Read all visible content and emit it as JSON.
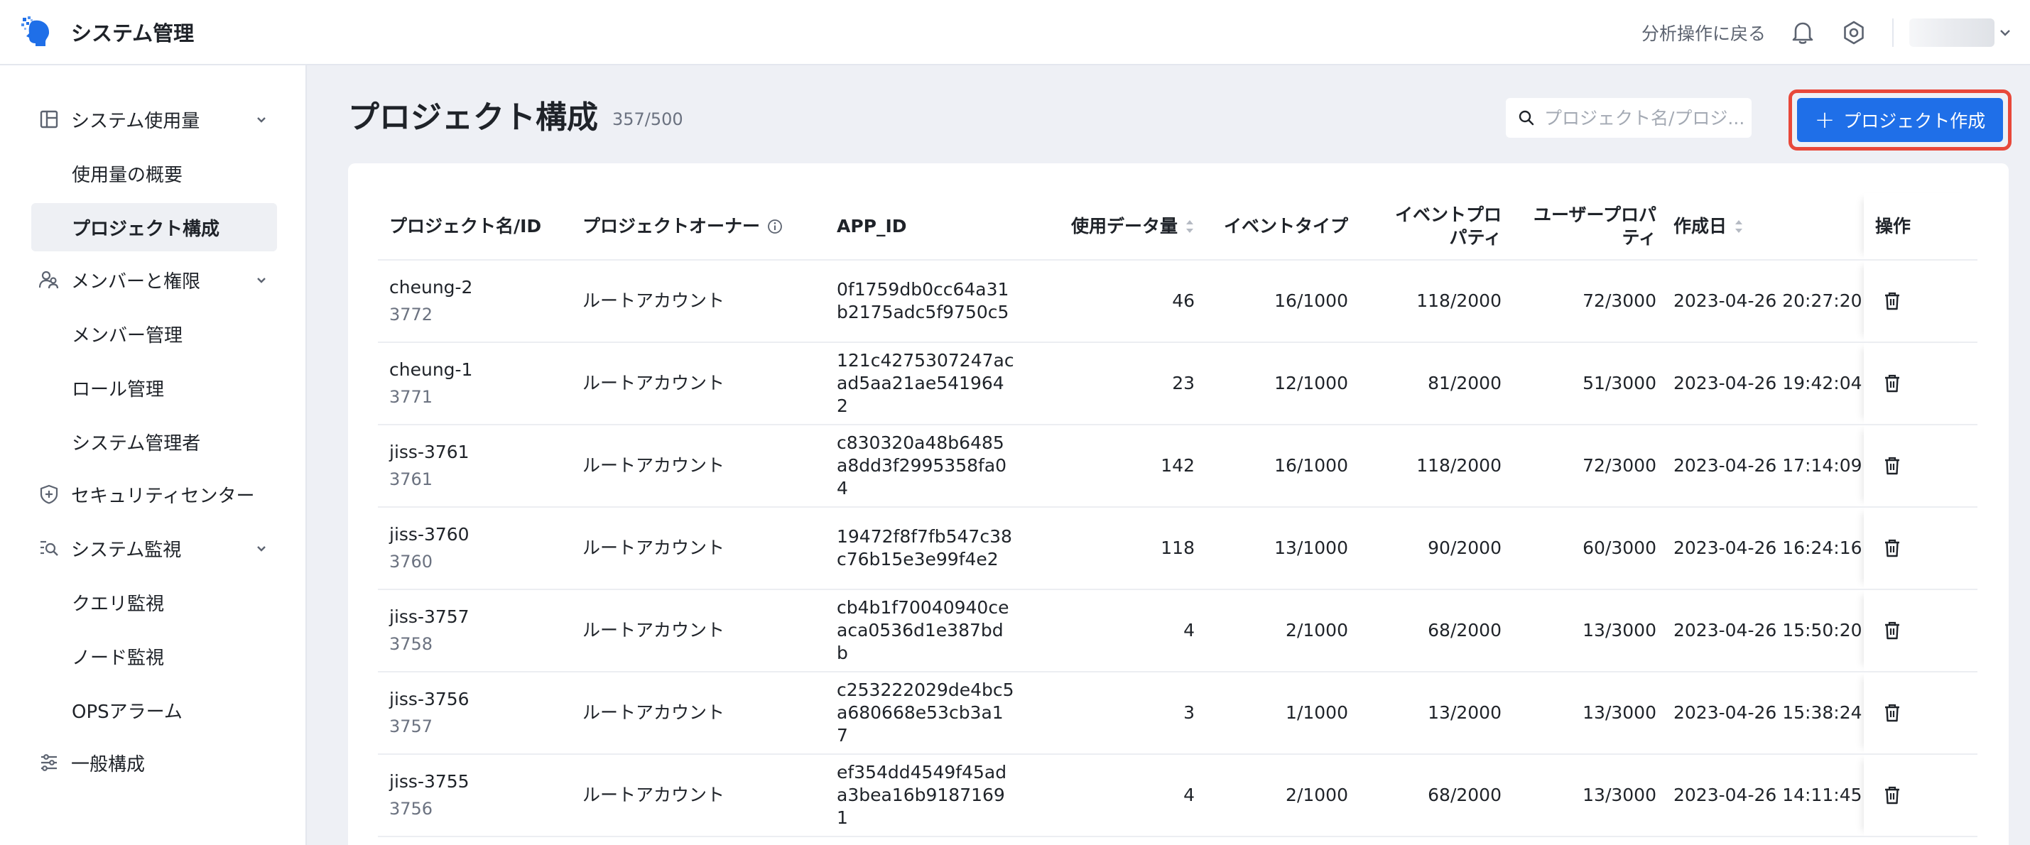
{
  "header": {
    "title": "システム管理",
    "back_link": "分析操作に戻る",
    "icons": [
      "bell-icon",
      "gear-icon",
      "chevron-down-icon"
    ]
  },
  "sidebar": {
    "groups": [
      {
        "label": "システム使用量",
        "icon": "layout-icon",
        "expandable": true,
        "items": [
          {
            "label": "使用量の概要"
          },
          {
            "label": "プロジェクト構成",
            "active": true
          }
        ]
      },
      {
        "label": "メンバーと権限",
        "icon": "users-icon",
        "expandable": true,
        "items": [
          {
            "label": "メンバー管理"
          },
          {
            "label": "ロール管理"
          },
          {
            "label": "システム管理者"
          }
        ]
      },
      {
        "label": "セキュリティセンター",
        "icon": "shield-icon",
        "expandable": false,
        "items": []
      },
      {
        "label": "システム監視",
        "icon": "monitor-icon",
        "expandable": true,
        "items": [
          {
            "label": "クエリ監視"
          },
          {
            "label": "ノード監視"
          },
          {
            "label": "OPSアラーム"
          }
        ]
      },
      {
        "label": "一般構成",
        "icon": "sliders-icon",
        "expandable": false,
        "items": []
      }
    ]
  },
  "main": {
    "title": "プロジェクト構成",
    "count": "357/500",
    "search": {
      "placeholder": "プロジェクト名/プロジ..."
    },
    "create_button": "プロジェクト作成",
    "accent_color": "#1f6fe8",
    "highlight_color": "#e8483a",
    "table": {
      "columns": [
        "プロジェクト名/ID",
        "プロジェクトオーナー",
        "APP_ID",
        "使用データ量",
        "イベントタイプ",
        "イベントプロパティ",
        "ユーザープロパティ",
        "作成日",
        "操作"
      ],
      "rows": [
        {
          "name": "cheung-2",
          "id": "3772",
          "owner": "ルートアカウント",
          "app_id": "0f1759db0cc64a31b2175adc5f9750c5",
          "usage": "46",
          "event_types": "16/1000",
          "event_props": "118/2000",
          "user_props": "72/3000",
          "created": "2023-04-26 20:27:20"
        },
        {
          "name": "cheung-1",
          "id": "3771",
          "owner": "ルートアカウント",
          "app_id": "121c4275307247acad5aa21ae5419642",
          "usage": "23",
          "event_types": "12/1000",
          "event_props": "81/2000",
          "user_props": "51/3000",
          "created": "2023-04-26 19:42:04"
        },
        {
          "name": "jiss-3761",
          "id": "3761",
          "owner": "ルートアカウント",
          "app_id": "c830320a48b6485a8dd3f2995358fa04",
          "usage": "142",
          "event_types": "16/1000",
          "event_props": "118/2000",
          "user_props": "72/3000",
          "created": "2023-04-26 17:14:09"
        },
        {
          "name": "jiss-3760",
          "id": "3760",
          "owner": "ルートアカウント",
          "app_id": "19472f8f7fb547c38c76b15e3e99f4e2",
          "usage": "118",
          "event_types": "13/1000",
          "event_props": "90/2000",
          "user_props": "60/3000",
          "created": "2023-04-26 16:24:16"
        },
        {
          "name": "jiss-3757",
          "id": "3758",
          "owner": "ルートアカウント",
          "app_id": "cb4b1f70040940ceaca0536d1e387bdb",
          "usage": "4",
          "event_types": "2/1000",
          "event_props": "68/2000",
          "user_props": "13/3000",
          "created": "2023-04-26 15:50:20"
        },
        {
          "name": "jiss-3756",
          "id": "3757",
          "owner": "ルートアカウント",
          "app_id": "c253222029de4bc5a680668e53cb3a17",
          "usage": "3",
          "event_types": "1/1000",
          "event_props": "13/2000",
          "user_props": "13/3000",
          "created": "2023-04-26 15:38:24"
        },
        {
          "name": "jiss-3755",
          "id": "3756",
          "owner": "ルートアカウント",
          "app_id": "ef354dd4549f45ada3bea16b91871691",
          "usage": "4",
          "event_types": "2/1000",
          "event_props": "68/2000",
          "user_props": "13/3000",
          "created": "2023-04-26 14:11:45"
        }
      ]
    }
  }
}
